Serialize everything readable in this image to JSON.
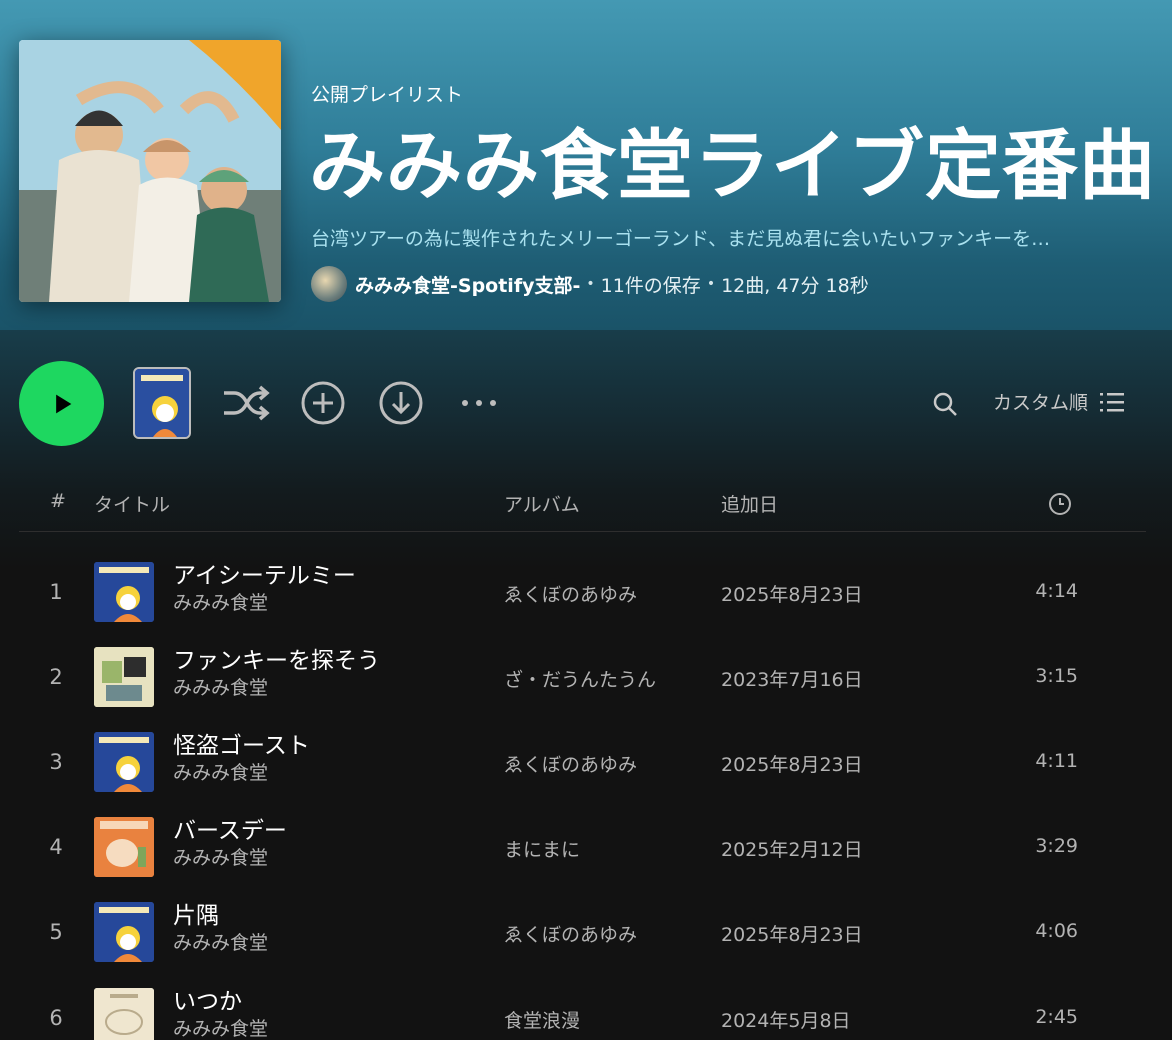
{
  "header": {
    "type_label": "公開プレイリスト",
    "title": "みみみ食堂ライブ定番曲",
    "description": "台湾ツアーの為に製作されたメリーゴーランド、まだ見ぬ君に会いたいファンキーを…",
    "owner": "みみみ食堂-Spotify支部-",
    "saves": "11件の保存",
    "stats": "12曲, 47分 18秒"
  },
  "actions": {
    "sort_label": "カスタム順"
  },
  "columns": {
    "num": "#",
    "title": "タイトル",
    "album": "アルバム",
    "date_added": "追加日"
  },
  "tracks": [
    {
      "num": "1",
      "title": "アイシーテルミー",
      "artist": "みみみ食堂",
      "album": "ゑくぼのあゆみ",
      "date": "2025年8月23日",
      "duration": "4:14",
      "thumb": "blue"
    },
    {
      "num": "2",
      "title": "ファンキーを探そう",
      "artist": "みみみ食堂",
      "album": "ざ・だうんたうん",
      "date": "2023年7月16日",
      "duration": "3:15",
      "thumb": "green"
    },
    {
      "num": "3",
      "title": "怪盗ゴースト",
      "artist": "みみみ食堂",
      "album": "ゑくぼのあゆみ",
      "date": "2025年8月23日",
      "duration": "4:11",
      "thumb": "blue"
    },
    {
      "num": "4",
      "title": "バースデー",
      "artist": "みみみ食堂",
      "album": "まにまに",
      "date": "2025年2月12日",
      "duration": "3:29",
      "thumb": "orange"
    },
    {
      "num": "5",
      "title": "片隅",
      "artist": "みみみ食堂",
      "album": "ゑくぼのあゆみ",
      "date": "2025年8月23日",
      "duration": "4:06",
      "thumb": "blue"
    },
    {
      "num": "6",
      "title": "いつか",
      "artist": "みみみ食堂",
      "album": "食堂浪漫",
      "date": "2024年5月8日",
      "duration": "2:45",
      "thumb": "cream"
    }
  ],
  "colors": {
    "accent_green": "#1ed760",
    "header_top": "#4499b3",
    "description_text": "#a9e1ef"
  }
}
